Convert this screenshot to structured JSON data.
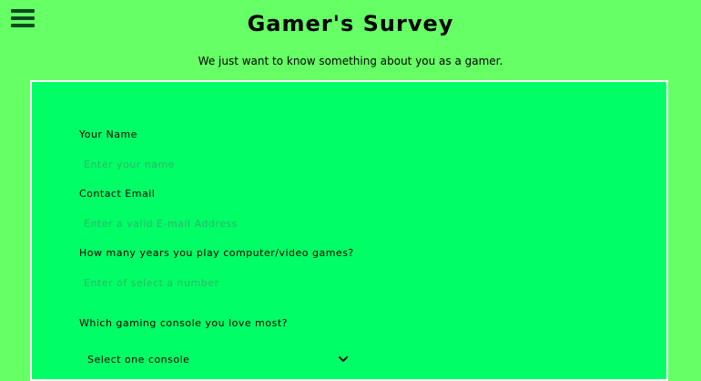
{
  "header": {
    "menu_icon": "hamburger-menu-icon",
    "title": "Gamer's Survey",
    "subtitle": "We just want to know something about you as a gamer."
  },
  "form": {
    "name": {
      "label": "Your Name",
      "placeholder": "Enter your name",
      "value": ""
    },
    "email": {
      "label": "Contact Email",
      "placeholder": "Enter a valid E-mail Address",
      "value": ""
    },
    "years": {
      "label": "How many years you play computer/video games?",
      "placeholder": "Enter of select a number",
      "value": ""
    },
    "console": {
      "label": "Which gaming console you love most?",
      "selected": "Select one console",
      "icon": "chevron-down-icon"
    }
  },
  "colors": {
    "page_bg": "#66ff66",
    "form_bg": "#00ff66",
    "form_border": "#ffffff",
    "placeholder": "#2fb56a",
    "menu_icon": "#0d4a1f"
  }
}
